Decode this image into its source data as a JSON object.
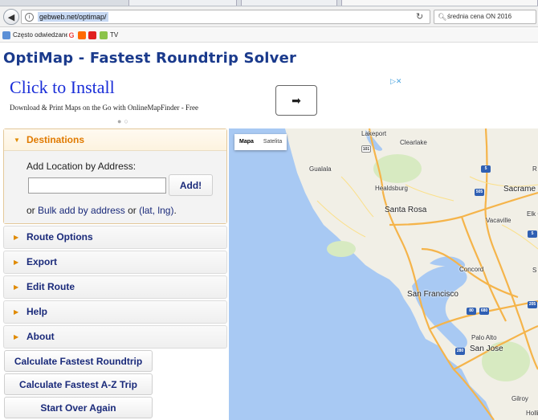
{
  "browser": {
    "url": "gebweb.net/optimap/",
    "search_text": "średnia cena ON 2016",
    "bookmarks": [
      {
        "label": "Często odwiedzane",
        "icon": "bookmarks-star-icon"
      },
      {
        "label": "",
        "icon": "google-icon"
      },
      {
        "label": "",
        "icon": "allegro-icon"
      },
      {
        "label": "",
        "icon": "youtube-icon"
      },
      {
        "label": "TV",
        "icon": "tv-icon"
      }
    ]
  },
  "page": {
    "title": "OptiMap - Fastest Roundtrip Solver"
  },
  "ad": {
    "title": "Click to Install",
    "subtitle": "Download & Print Maps on the Go with OnlineMapFinder - Free",
    "arrow": "➡",
    "choices": "▷✕"
  },
  "sidebar": {
    "destinations": {
      "label": "Destinations",
      "address_label": "Add Location by Address:",
      "address_value": "",
      "add_button": "Add!",
      "bulk_prefix": "or ",
      "bulk_link_1": "Bulk add by address",
      "bulk_middle": " or ",
      "bulk_link_2": "(lat, lng)",
      "bulk_suffix": "."
    },
    "sections": [
      {
        "label": "Route Options"
      },
      {
        "label": "Export"
      },
      {
        "label": "Edit Route"
      },
      {
        "label": "Help"
      },
      {
        "label": "About"
      }
    ],
    "buttons": [
      {
        "label": "Calculate Fastest Roundtrip"
      },
      {
        "label": "Calculate Fastest A-Z Trip"
      },
      {
        "label": "Start Over Again"
      }
    ]
  },
  "map": {
    "map_type_buttons": [
      {
        "label": "Mapa",
        "active": true
      },
      {
        "label": "Satelita",
        "active": false
      }
    ],
    "cities": [
      "Lakeport",
      "Clearlake",
      "Gualala",
      "Healdsburg",
      "Santa Rosa",
      "Vacaville",
      "Sacrame",
      "Elk G",
      "Concord",
      "San Francisco",
      "Palo Alto",
      "San Jose",
      "Gilroy",
      "Holli",
      "R",
      "S"
    ],
    "road_numbers": [
      "101",
      "5",
      "505",
      "80",
      "680",
      "280",
      "205",
      "5"
    ],
    "colors": {
      "water": "#a8c9f3",
      "land": "#f1efe6",
      "highway": "#f5b44a",
      "park": "#cfe6b4"
    }
  }
}
